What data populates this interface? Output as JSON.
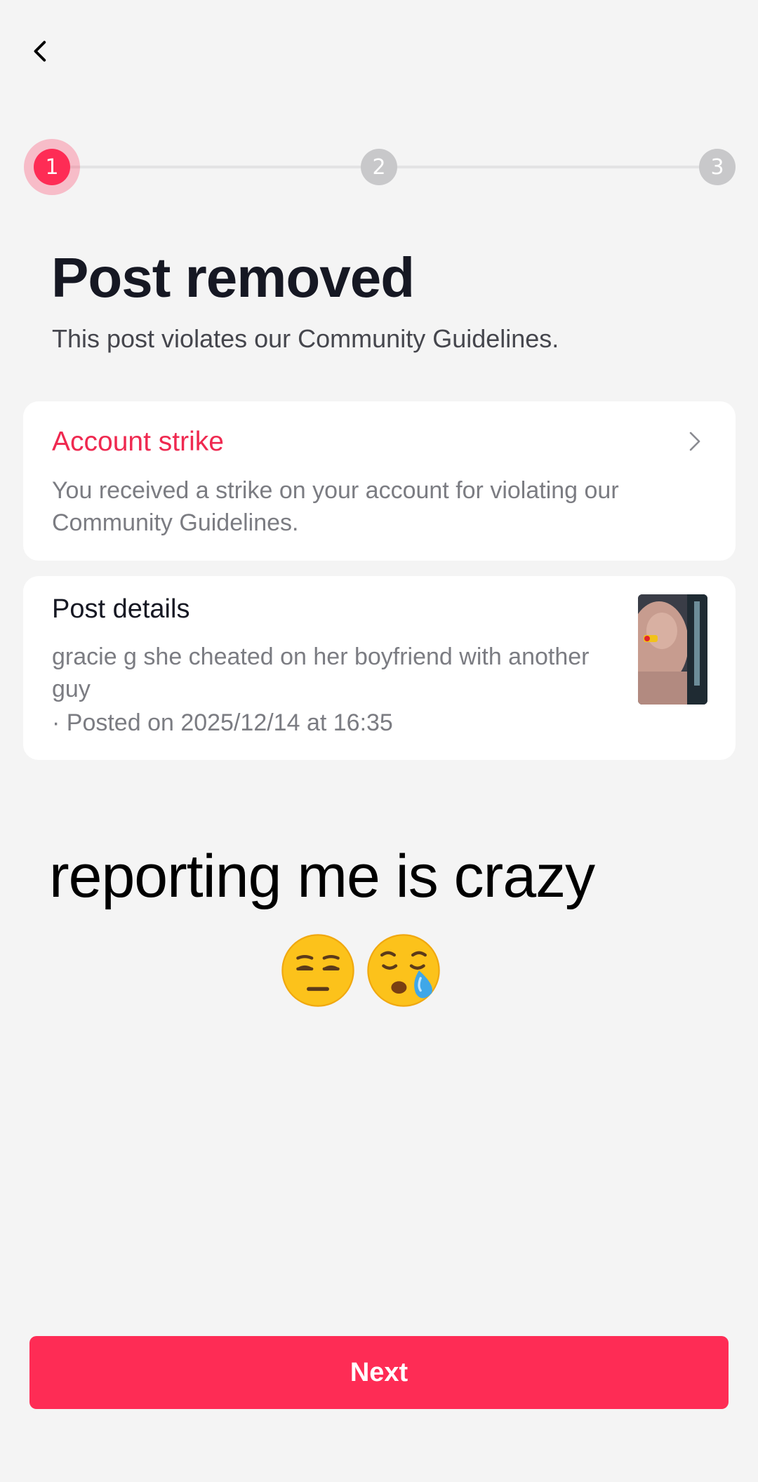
{
  "nav": {
    "back_icon": "chevron-left-icon"
  },
  "stepper": {
    "steps": [
      "1",
      "2",
      "3"
    ],
    "current_step": 1,
    "accent_color": "#fe2c55"
  },
  "header": {
    "title": "Post removed",
    "subtitle": "This post violates our Community Guidelines."
  },
  "strike_card": {
    "title": "Account strike",
    "description": "You received a strike on your account for violating our Community Guidelines.",
    "chevron_icon": "chevron-right-icon"
  },
  "post_details": {
    "title": "Post details",
    "caption": "gracie g she cheated on her boyfriend with another guy",
    "posted": "· Posted on 2025/12/14 at 16:35"
  },
  "overlay": {
    "text": "reporting me is crazy",
    "emojis": [
      "relieved-face-icon",
      "sleepy-face-icon"
    ]
  },
  "footer": {
    "next_label": "Next"
  },
  "colors": {
    "accent": "#fe2c55",
    "background": "#f4f4f4",
    "card": "#ffffff"
  }
}
